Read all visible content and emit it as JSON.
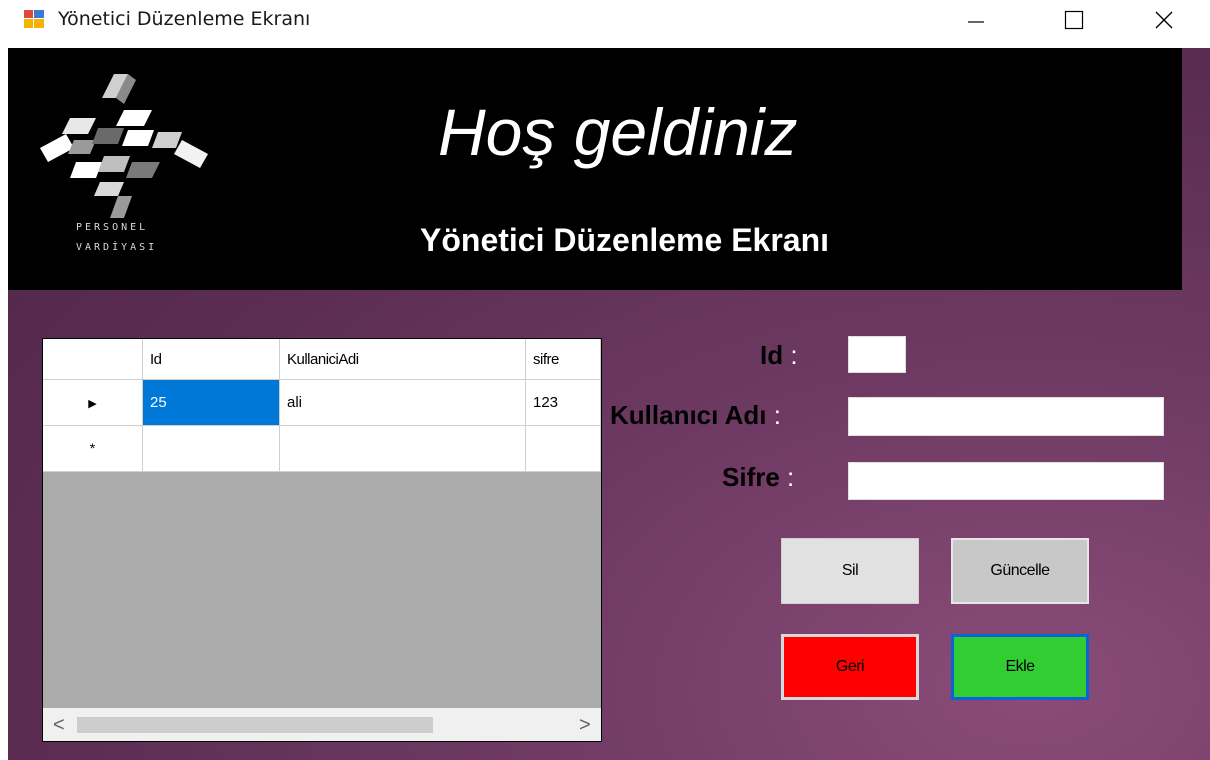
{
  "window": {
    "title": "Yönetici Düzenleme Ekranı",
    "icon": "app-form-icon"
  },
  "banner": {
    "logo_line1": "PERSONEL",
    "logo_line2": "VARDİYASI",
    "welcome": "Hoş geldiniz",
    "subtitle": "Yönetici Düzenleme Ekranı"
  },
  "grid": {
    "columns": [
      "Id",
      "KullaniciAdi",
      "sifre"
    ],
    "rows": [
      {
        "indicator": "▶",
        "cells": [
          "25",
          "ali",
          "123"
        ]
      }
    ],
    "new_row_indicator": "*",
    "scroll_left": "<",
    "scroll_right": ">"
  },
  "form": {
    "id_label": "Id",
    "username_label": "Kullanıcı Adı",
    "password_label": "Sifre",
    "colon": ":",
    "id_value": "",
    "username_value": "",
    "password_value": ""
  },
  "buttons": {
    "delete": "Sil",
    "update": "Güncelle",
    "back": "Geri",
    "add": "Ekle"
  },
  "colors": {
    "back_button": "#ff0000",
    "add_button": "#32cd32",
    "selection": "#0078d7",
    "background": "#5a2c52"
  }
}
